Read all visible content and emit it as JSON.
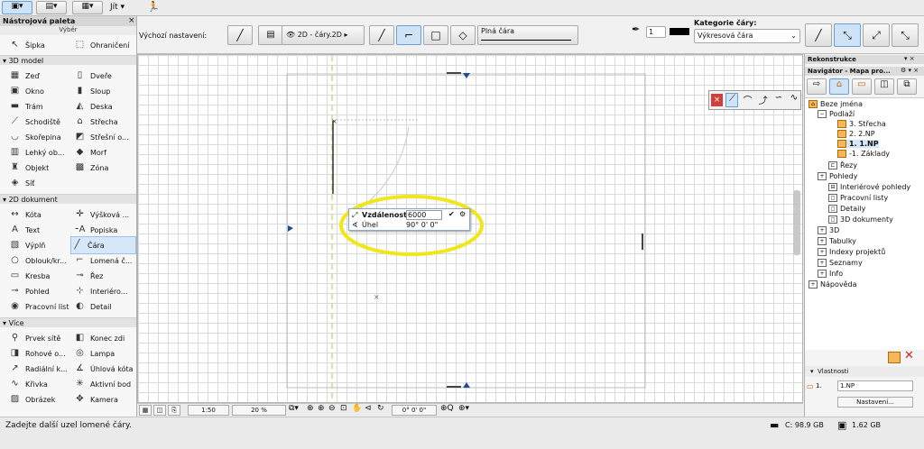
{
  "topbar": {
    "btns": [
      "▣▾",
      "▤▾",
      "▦▾"
    ],
    "menu": "Jít ▾",
    "run_icon": "🏃"
  },
  "palette": {
    "title": "Nástrojová paleta",
    "close": "×",
    "select_label": "Výběr",
    "arrow_tool": "Šipka",
    "marquee_tool": "Ohraničení",
    "sec_3d": "3D model",
    "tools_3d": [
      "Zeď",
      "Dveře",
      "Okno",
      "Sloup",
      "Trám",
      "Deska",
      "Schodiště",
      "Střecha",
      "Skořepina",
      "Střešní o...",
      "Lehký ob...",
      "Morf",
      "Objekt",
      "Zóna",
      "Síť"
    ],
    "sec_2d": "2D dokument",
    "tools_2d": [
      "Kóta",
      "Výšková ...",
      "Text",
      "Popiska",
      "Výplň",
      "Čára",
      "Oblouk/kr...",
      "Lomená č...",
      "Kresba",
      "Řez",
      "Pohled",
      "Interiéro...",
      "Pracovní list",
      "Detail"
    ],
    "sec_more": "Více",
    "tools_more": [
      "Prvek sítě",
      "Konec zdi",
      "Rohové o...",
      "Lampa",
      "Radiální k...",
      "Úhlová kóta",
      "Křivka",
      "Aktivní bod",
      "Obrázek",
      "Kamera"
    ]
  },
  "options": {
    "default_label": "Výchozí nastavení:",
    "layer": "2D - čáry.2D",
    "linetype": "Plná čára",
    "pen_value": "1",
    "category_label": "Kategorie čáry:",
    "category_value": "Výkresová čára"
  },
  "canvas": {
    "dist_label": "Vzdálenost",
    "dist_value": "6000",
    "angle_label": "Úhel",
    "angle_value": "90° 0' 0\"",
    "highlight_color": "#f0e61a"
  },
  "bottombar": {
    "scale": "1:50",
    "zoom": "20 %",
    "angle": "0° 0' 0\""
  },
  "right": {
    "rekonstrukce": "Rekonstrukce",
    "navigator": "Navigátor - Mapa pro...",
    "tree": [
      "Beze jména",
      "Podlaží",
      "3. Střecha",
      "2. 2.NP",
      "1. 1.NP",
      "-1. Základy",
      "Řezy",
      "Pohledy",
      "Interiérové pohledy",
      "Pracovní listy",
      "Detaily",
      "3D dokumenty",
      "3D",
      "Tabulky",
      "Indexy projektů",
      "Seznamy",
      "Info",
      "Nápověda"
    ],
    "vlastnosti": "Vlastnosti",
    "prop_num": "1.",
    "prop_val": "1.NP",
    "settings_btn": "Nastavení..."
  },
  "status": {
    "message": "Zadejte další uzel lomené čáry.",
    "disk": "C: 98.9 GB",
    "ram": "1.62 GB"
  }
}
